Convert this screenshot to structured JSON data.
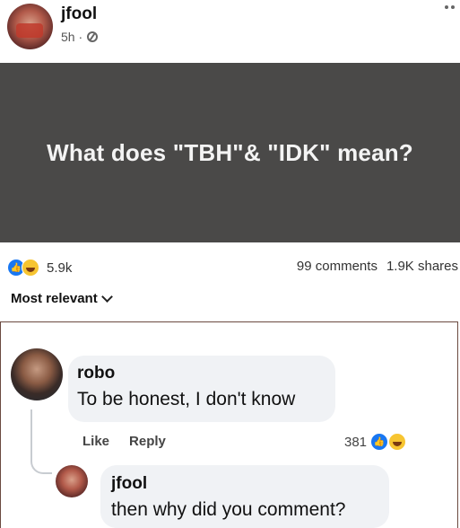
{
  "post": {
    "author": "jfool",
    "time": "5h ·",
    "text": "What does \"TBH\"& \"IDK\" mean?"
  },
  "reactions": {
    "count": "5.9k",
    "comments": "99 comments",
    "shares": "1.9K shares"
  },
  "sort": {
    "label": "Most relevant"
  },
  "comment": {
    "author": "robo",
    "text": "To be honest, I don't know",
    "like_label": "Like",
    "reply_label": "Reply",
    "reaction_count": "381"
  },
  "reply": {
    "author": "jfool",
    "text": "then why did you comment?"
  },
  "colors": {
    "card_bg": "#4a4948",
    "like_blue": "#1877f2",
    "haha_yellow": "#f7c531",
    "bubble_bg": "#f0f2f5"
  }
}
